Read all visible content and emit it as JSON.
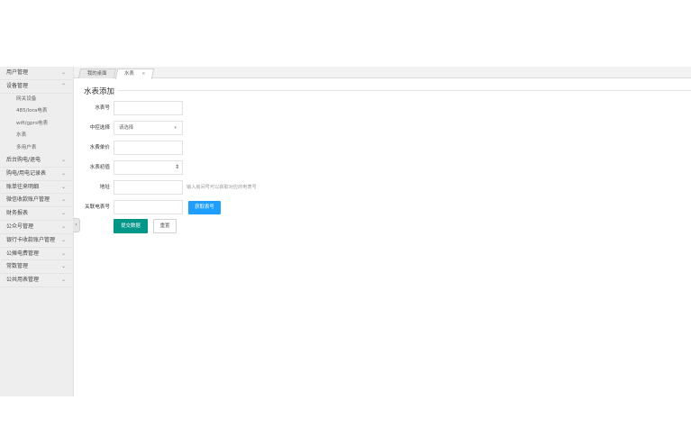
{
  "sidebar": {
    "items": [
      {
        "label": "用户管理",
        "chevron": "chevron-down-icon"
      },
      {
        "label": "设备管理",
        "chevron": "chevron-up-icon",
        "expanded": true,
        "children": [
          "网关设备",
          "485/lora电表",
          "wifi/gprs电表",
          "水表",
          "多用户表"
        ]
      },
      {
        "label": "后台购电/退电",
        "chevron": "chevron-down-icon"
      },
      {
        "label": "购电/用电记录表",
        "chevron": "chevron-down-icon"
      },
      {
        "label": "账单往来明细",
        "chevron": "chevron-down-icon"
      },
      {
        "label": "微信收款账户管理",
        "chevron": "chevron-down-icon"
      },
      {
        "label": "财务报表",
        "chevron": "chevron-down-icon"
      },
      {
        "label": "公众号管理",
        "chevron": "chevron-down-icon"
      },
      {
        "label": "银行卡收款账户管理",
        "chevron": "chevron-down-icon"
      },
      {
        "label": "公摊电费管理",
        "chevron": "chevron-down-icon"
      },
      {
        "label": "常数管理",
        "chevron": "chevron-down-icon"
      },
      {
        "label": "公共用表管理",
        "chevron": "chevron-down-icon"
      }
    ]
  },
  "tabs": [
    {
      "label": "我的桌面",
      "active": false
    },
    {
      "label": "水表",
      "active": true,
      "close": "×"
    }
  ],
  "form": {
    "legend": "水表添加",
    "fields": [
      {
        "label": "水表号",
        "value": "",
        "placeholder": ""
      },
      {
        "label": "中控选择",
        "value": "请选择"
      },
      {
        "label": "水费单价",
        "value": "",
        "placeholder": ""
      },
      {
        "label": "水表初值",
        "value": ""
      },
      {
        "label": "地址",
        "value": "",
        "placeholder": "",
        "hint": "输入房间号可以获取对应的电表号"
      },
      {
        "label": "关联电表号",
        "value": "",
        "placeholder": "",
        "button": "获取表号"
      }
    ],
    "submit_label": "提交数据",
    "reset_label": "重置"
  },
  "colors": {
    "primary": "#009688",
    "info": "#1e9fff",
    "sidebar_bg": "#eeeeee"
  }
}
